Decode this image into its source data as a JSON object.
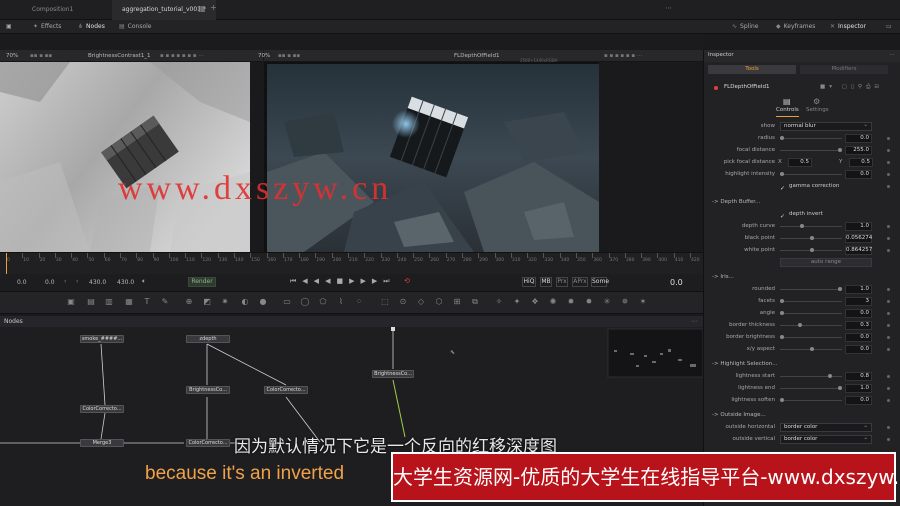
{
  "tabs": [
    {
      "label": "Composition1"
    },
    {
      "label": "aggregation_tutorial_v001 *"
    }
  ],
  "toolbar": {
    "effects": "Effects",
    "nodes": "Nodes",
    "console": "Console",
    "spline": "Spline",
    "keyframes": "Keyframes",
    "inspector": "Inspector"
  },
  "viewer_left": {
    "zoom": "70%",
    "title": "BrightnessContrast1_1"
  },
  "viewer_right": {
    "zoom": "70%",
    "title": "FLDepthOfField1",
    "resolution": "2560×1440xRGBA"
  },
  "timeline": {
    "ticks": [
      "0",
      "10",
      "20",
      "30",
      "40",
      "50",
      "60",
      "70",
      "80",
      "90",
      "100",
      "110",
      "120",
      "130",
      "140",
      "150",
      "160",
      "170",
      "180",
      "190",
      "200",
      "210",
      "220",
      "230",
      "240",
      "250",
      "260",
      "270",
      "280",
      "290",
      "300",
      "310",
      "320",
      "330",
      "340",
      "350",
      "360",
      "370",
      "380",
      "390",
      "400",
      "410",
      "420"
    ]
  },
  "transport": {
    "start": "0.0",
    "current": "0.0",
    "end": "430.0",
    "render_end": "430.0",
    "render_label": "Render",
    "hiq": "HiQ",
    "mb": "MB",
    "prx": "Prx",
    "aprx": "APrx",
    "some": "Some",
    "frame": "0.0"
  },
  "nodes_panel": {
    "title": "Nodes",
    "nodes": [
      {
        "label": "smoke_####..."
      },
      {
        "label": "zdepth"
      },
      {
        "label": "BrightnessCo..."
      },
      {
        "label": "BrightnessCo..."
      },
      {
        "label": "ColorCorrecto..."
      },
      {
        "label": "ColorCorrecto..."
      },
      {
        "label": "Merge3"
      },
      {
        "label": "ColorCorrecto..."
      }
    ]
  },
  "inspector": {
    "title": "Inspector",
    "tab_tools": "Tools",
    "tab_modifiers": "Modifiers",
    "node_name": "FLDepthOfField1",
    "sub_controls": "Controls",
    "sub_settings": "Settings",
    "show_label": "show",
    "show_value": "normal blur",
    "radius_label": "radius",
    "radius_value": "0.0",
    "focal_label": "focal distance",
    "focal_value": "255.0",
    "pick_label": "pick focal distance",
    "pick_x_label": "X",
    "pick_x": "0.5",
    "pick_y_label": "Y",
    "pick_y": "0.5",
    "highlight_label": "highlight intensity",
    "highlight_value": "0.0",
    "gamma_label": "gamma correction",
    "section_depth": "-> Depth Buffer...",
    "depth_invert": "depth invert",
    "depth_curve_label": "depth curve",
    "depth_curve_value": "1.0",
    "black_label": "black point",
    "black_value": "0.056274",
    "white_label": "white point",
    "white_value": "0.864257",
    "auto_range": "auto range",
    "section_iris": "-> Iris...",
    "rounded_label": "rounded",
    "rounded_value": "1.0",
    "facets_label": "facets",
    "facets_value": "3",
    "angle_label": "angle",
    "angle_value": "0.0",
    "border_thick_label": "border thickness",
    "border_thick_value": "0.3",
    "border_bright_label": "border brightness",
    "border_bright_value": "0.0",
    "xy_label": "x/y aspect",
    "xy_value": "0.0",
    "section_highlight": "-> Highlight Selection...",
    "light_start_label": "lightness start",
    "light_start_value": "0.8",
    "light_end_label": "lightness end",
    "light_end_value": "1.0",
    "light_soften_label": "lightness soften",
    "light_soften_value": "0.0",
    "section_outside": "-> Outside Image...",
    "outside_h_label": "outside horizontal",
    "outside_h_value": "border color",
    "outside_v_label": "outside vertical",
    "outside_v_value": "border color"
  },
  "overlay": {
    "watermark": "www.dxszyw.cn",
    "subtitle_cn": "因为默认情况下它是一个反向的红移深度图",
    "subtitle_en": "because it's an inverted",
    "banner": "大学生资源网-优质的大学生在线指导平台-www.dxszyw.cn"
  },
  "colors": {
    "accent": "#e8a13a",
    "banner_bg": "#b8131a",
    "subtitle_en": "#f0a24a",
    "watermark": "#e13030"
  }
}
